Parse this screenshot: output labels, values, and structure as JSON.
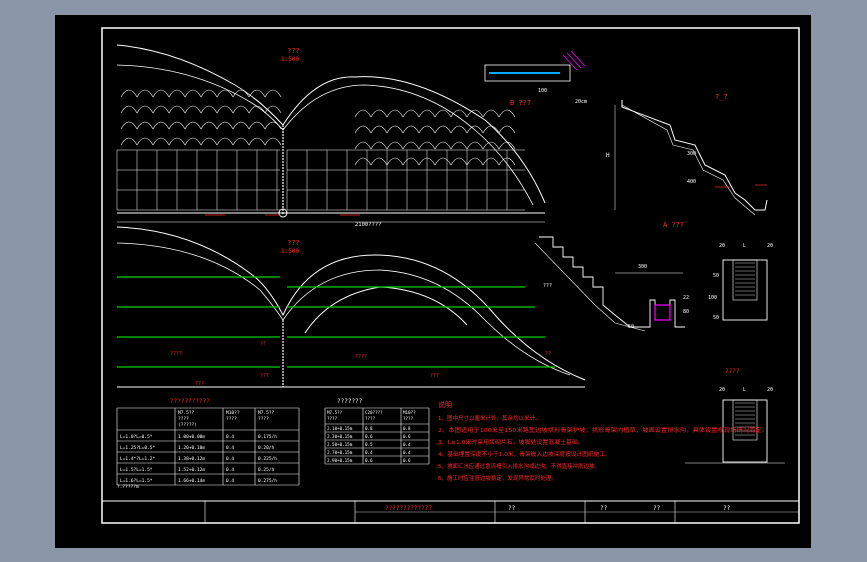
{
  "drawing": {
    "elevation_title": "???",
    "elevation_scale": "1:500",
    "plan_title": "???",
    "plan_scale": "1:500",
    "total_length": "2100????",
    "mid_label": "???",
    "detail_b_title": "B ???",
    "detail_b_dim_100": "100",
    "detail_b_dim_20cm": "20cm",
    "section_title": "?_?",
    "section_h": "H",
    "section_300": "300",
    "section_400": "400",
    "detail_a_title": "A ???",
    "detail_a_dim_300": "300",
    "detail_a_dim_50": "50",
    "detail_a_dim_80": "80",
    "detail_a_dim_22": "22",
    "right_detail_top_dims": [
      "20",
      "L",
      "20"
    ],
    "right_detail_dims": [
      "50",
      "100",
      "50"
    ],
    "right_detail_bottom_title": "????",
    "right_detail_bottom_dims": [
      "20",
      "L",
      "20"
    ],
    "left_tag": "???",
    "plan_labels": [
      "????",
      "??",
      "????",
      "???",
      "???",
      "??",
      "???"
    ]
  },
  "table1": {
    "title": "???????????",
    "headers": [
      "",
      "M7.5??\n????\n(?????)",
      "M10??\n????",
      "M7.5??\n????"
    ],
    "rows": [
      [
        "L=1.0?L=0.5*",
        "1.00+0.00m",
        "0.4",
        "0.175/h"
      ],
      [
        "L=1.25?L=0.5*",
        "1.20+0.10m",
        "0.4",
        "0.20/h"
      ],
      [
        "L=1.4*?L=1.2*",
        "1.38+0.12m",
        "0.4",
        "0.225/h"
      ],
      [
        "L=1.5?L=1.5*",
        "1.52+0.12m",
        "0.4",
        "0.25/h"
      ],
      [
        "L=1.6?L=1.5*",
        "1.66+0.14m",
        "0.4",
        "0.275/h"
      ]
    ],
    "note": "?.?????m"
  },
  "table2": {
    "title": "???????",
    "rows": [
      [
        "M7.5??\n????",
        "C20????\n????",
        "M10??\n????"
      ],
      [
        "2.10+0.15m",
        "0.8",
        "0.8"
      ],
      [
        "2.30+0.15m",
        "0.6",
        "0.6"
      ],
      [
        "2.50+0.15m",
        "0.5",
        "0.4"
      ],
      [
        "2.70+0.15m",
        "0.4",
        "0.4"
      ],
      [
        "2.90+0.15m",
        "0.6",
        "0.6"
      ]
    ]
  },
  "notes": {
    "heading": "说明",
    "lines": [
      "1、图中尺寸以厘米计外，其余均以米计。",
      "2、本图适用于100米至150米路堑边坡拱形骨架护坡，拱形骨架内植草，坡面设置排水沟，具体设置视现场情况而定。",
      "3、L≥1.0米时采用浆砌片石，坡脚处设置混凝土基础。",
      "4、基础埋置深度不小于1.0米，骨架嵌入边坡深度按设计图纸施工。",
      "5、坡面汇水应通过急流槽引入排水沟或边沟，不得直接冲刷边坡。",
      "6、施工时应注意边坡稳定，发现异常及时处理。"
    ]
  },
  "title_block": {
    "main_title": "?????????????",
    "cells": [
      "??",
      "??",
      "??",
      "??"
    ]
  },
  "colors": {
    "background": "#000000",
    "frame": "#ffffff",
    "title": "#ff2a2a",
    "dims": "#ffffff",
    "green": "#00d000",
    "magenta": "#ff00ff",
    "screen_bg": "#8a95a8"
  }
}
